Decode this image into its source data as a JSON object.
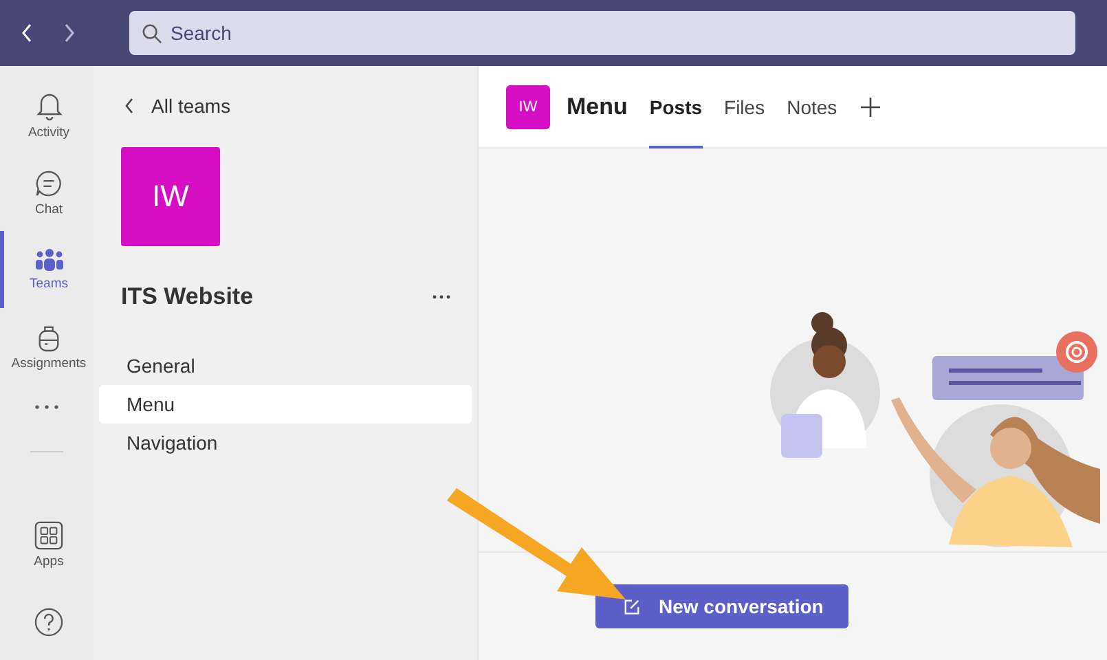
{
  "search": {
    "placeholder": "Search"
  },
  "rail": {
    "items": [
      {
        "kind": "bell",
        "label": "Activity",
        "selected": false
      },
      {
        "kind": "chat",
        "label": "Chat",
        "selected": false
      },
      {
        "kind": "teams",
        "label": "Teams",
        "selected": true
      },
      {
        "kind": "backpack",
        "label": "Assignments",
        "selected": false
      }
    ],
    "bottom_items": [
      {
        "kind": "apps",
        "label": "Apps",
        "selected": false
      },
      {
        "kind": "help",
        "selected": false
      }
    ]
  },
  "team": {
    "back_link": "All teams",
    "avatar": "IW",
    "name": "ITS Website",
    "channels": [
      {
        "label": "General",
        "selected": false
      },
      {
        "label": "Menu",
        "selected": true
      },
      {
        "label": "Navigation",
        "selected": false
      }
    ]
  },
  "header": {
    "avatar": "IW",
    "title": "Menu",
    "tabs": [
      {
        "label": "Posts",
        "selected": true
      },
      {
        "label": "Files",
        "selected": false
      },
      {
        "label": "Notes",
        "selected": false
      }
    ]
  },
  "compose": {
    "button": "New conversation"
  }
}
